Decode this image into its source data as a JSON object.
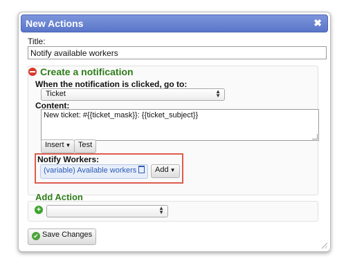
{
  "dialog": {
    "title": "New Actions",
    "close_symbol": "✖",
    "title_label": "Title:",
    "title_value": "Notify available workers"
  },
  "notification": {
    "heading": "Create a notification",
    "goto_label": "When the notification is clicked, go to:",
    "goto_value": "Ticket",
    "content_label": "Content:",
    "content_value": "New ticket: #{{ticket_mask}}: {{ticket_subject}}",
    "insert_label": "Insert",
    "test_label": "Test",
    "notify_label": "Notify Workers:",
    "worker_chip": "(variable) Available workers",
    "add_label": "Add"
  },
  "add_action": {
    "heading": "Add Action",
    "select_value": ""
  },
  "footer": {
    "save_label": "Save Changes"
  },
  "colors": {
    "titlebar": "#6a85d2",
    "heading_green": "#2f7d1a",
    "highlight_red": "#dd5a4e",
    "chip_blue": "#2a5ab8"
  }
}
